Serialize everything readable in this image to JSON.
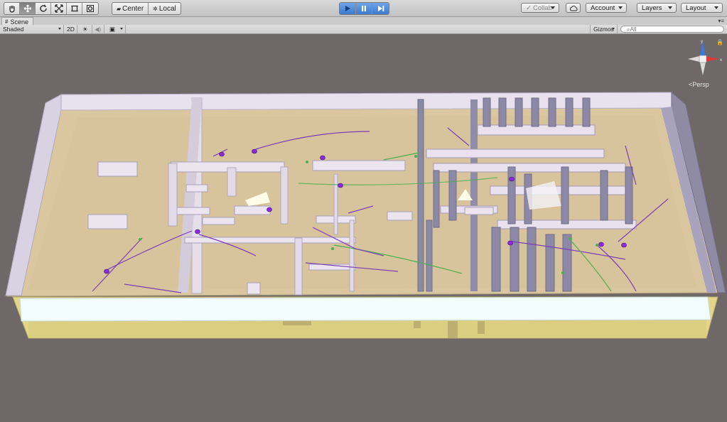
{
  "toolbar": {
    "tools": [
      "hand-tool",
      "move-tool",
      "rotate-tool",
      "scale-tool",
      "rect-tool",
      "transform-tool"
    ],
    "pivot_label": "Center",
    "space_label": "Local",
    "play_controls": [
      "play",
      "pause",
      "step"
    ],
    "collab_label": "Collab",
    "account_label": "Account",
    "layers_label": "Layers",
    "layout_label": "Layout"
  },
  "scene_tab": {
    "title": "Scene"
  },
  "scene_toolbar": {
    "shading_mode": "Shaded",
    "mode_2d": "2D",
    "gizmos_label": "Gizmos",
    "search_placeholder": "All"
  },
  "viewport": {
    "projection_label": "Persp",
    "gizmo_axes": {
      "y": "y",
      "x": "x"
    },
    "colors": {
      "background": "#6f6868",
      "floor": "#d9c39a",
      "walls": "#e6dfe9",
      "base": "#e6d786",
      "agents": "#8a2be2",
      "paths_purple": "#7b3fb5",
      "paths_green": "#4caf50"
    }
  }
}
